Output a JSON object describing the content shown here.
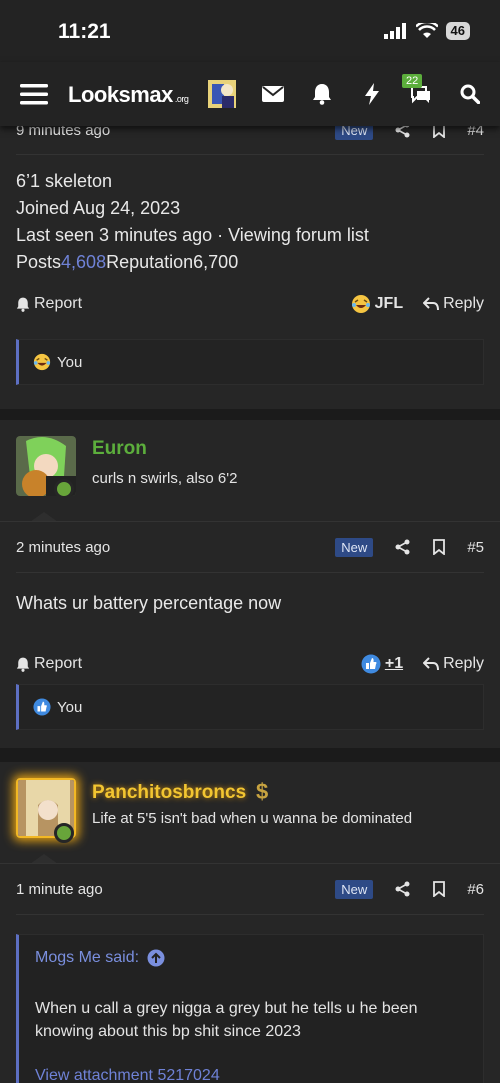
{
  "status": {
    "time": "11:21",
    "battery": "46"
  },
  "nav": {
    "logo_main": "Looksmax",
    "logo_suffix": ".org",
    "chat_count": "22"
  },
  "post4": {
    "date_partial": "9 minutes ago",
    "badge": "New",
    "number": "#4",
    "lines": [
      "6’1 skeleton",
      "Joined Aug 24, 2023",
      "Last seen 3 minutes ago · Viewing forum list"
    ],
    "posts_label": "Posts",
    "posts_value": "4,608",
    "rep_label": "Reputation",
    "rep_value": "6,700",
    "report": "Report",
    "reaction": "JFL",
    "reply": "Reply",
    "reacted_by": "You"
  },
  "post5": {
    "username": "Euron",
    "user_title": "curls n swirls, also 6'2",
    "username_color": "#5cae3c",
    "date": "2 minutes ago",
    "badge": "New",
    "number": "#5",
    "body": "Whats ur battery percentage now",
    "report": "Report",
    "reaction": "+1",
    "reply": "Reply",
    "reacted_by": "You"
  },
  "post6": {
    "username": "Panchitosbroncs",
    "user_title": "Life at 5'5 isn't bad when u wanna be dominated",
    "username_color": "#f2c531",
    "date": "1 minute ago",
    "badge": "New",
    "number": "#6",
    "quote_author": "Mogs Me said:",
    "quote_text": "When u call a grey nigga a grey but he tells u he been knowing about this bp shit since 2023",
    "attachment": "View attachment 5217024"
  },
  "icons": {
    "menu": "hamburger-icon",
    "mail": "envelope-icon",
    "bell": "bell-icon",
    "bolt": "lightning-icon",
    "chat": "chat-bubble-icon",
    "search": "search-icon"
  }
}
